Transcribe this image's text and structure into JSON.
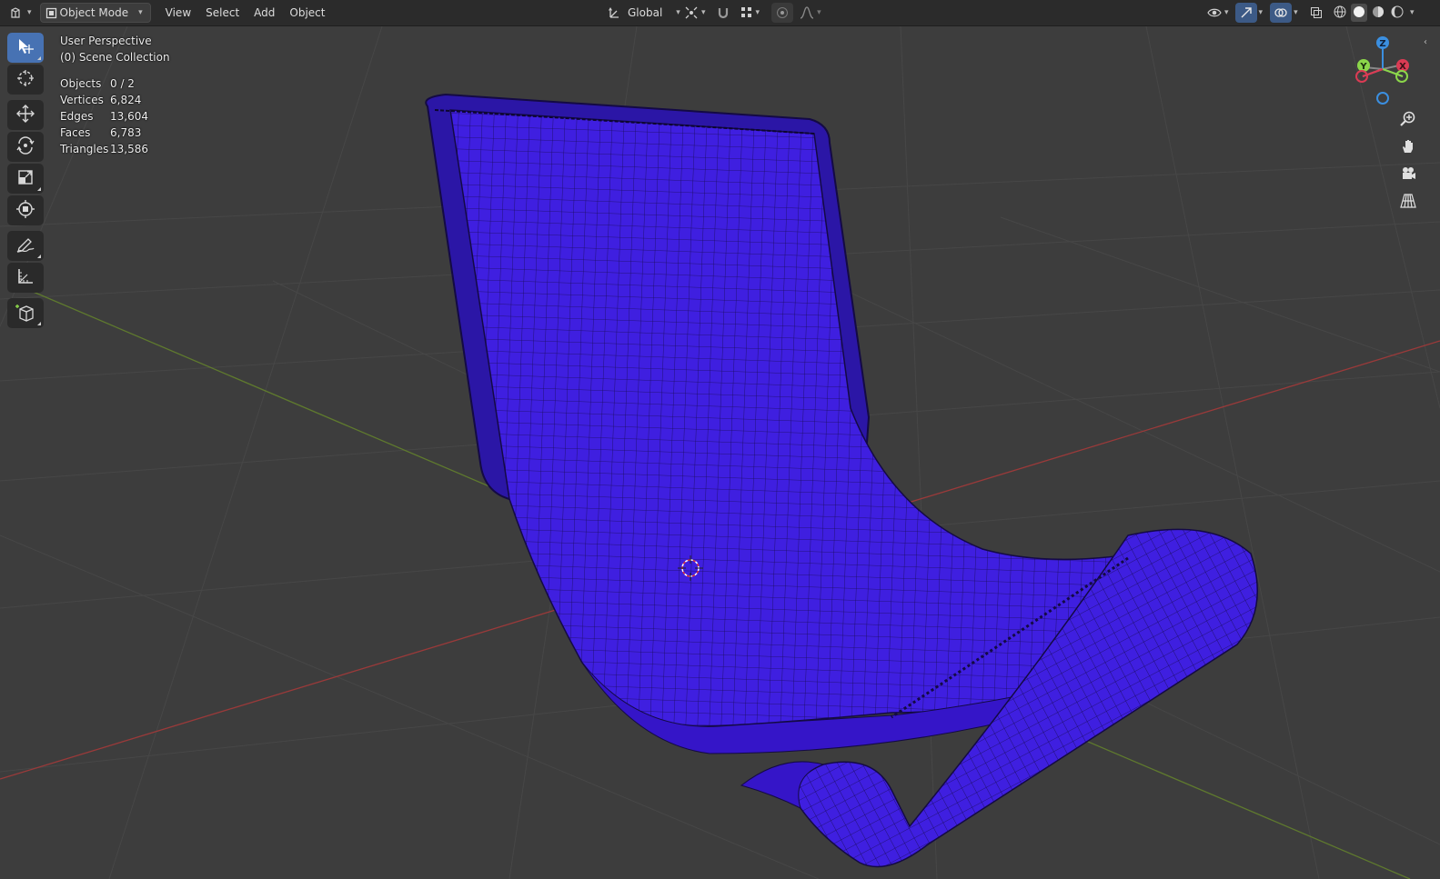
{
  "header": {
    "editor_icon": "3d-viewport-icon",
    "mode": {
      "icon": "object-mode-icon",
      "label": "Object Mode"
    },
    "menus": [
      "View",
      "Select",
      "Add",
      "Object"
    ],
    "orientation": {
      "icon": "transform-orientation-icon",
      "label": "Global"
    },
    "pivot_icon": "pivot-point-icon",
    "snap_icons": [
      "snap-magnet-icon",
      "snap-increment-icon"
    ],
    "proportional_icons": [
      "proportional-editing-icon",
      "falloff-curve-icon"
    ],
    "visibility_icons": [
      "selectability-eye-icon",
      "gizmo-toggle-icon",
      "overlay-toggle-icon",
      "xray-toggle-icon"
    ],
    "shading_modes": [
      "wireframe",
      "solid",
      "material-preview",
      "rendered"
    ],
    "active_shading": "solid"
  },
  "viewport": {
    "view_name": "User Perspective",
    "collection": "(0) Scene Collection",
    "stats": [
      {
        "label": "Objects",
        "value": "0 / 2"
      },
      {
        "label": "Vertices",
        "value": "6,824"
      },
      {
        "label": "Edges",
        "value": "13,604"
      },
      {
        "label": "Faces",
        "value": "6,783"
      },
      {
        "label": "Triangles",
        "value": "13,586"
      }
    ],
    "model_color": "#3f1fe0",
    "grid_color": "#474747",
    "x_axis_color": "#9a3a3a",
    "y_axis_color": "#5f7a2e"
  },
  "toolbar": {
    "tools": [
      "select-box",
      "cursor",
      "move",
      "rotate",
      "scale",
      "transform",
      "annotate",
      "measure",
      "add-cube"
    ],
    "active_tool": "select-box"
  },
  "gizmo": {
    "axes": [
      "X",
      "Y",
      "Z"
    ],
    "colors": {
      "x": "#db3b54",
      "y": "#8bd64a",
      "z": "#3b8fe0"
    }
  },
  "navigation": [
    "zoom",
    "pan",
    "camera",
    "perspective-toggle"
  ]
}
